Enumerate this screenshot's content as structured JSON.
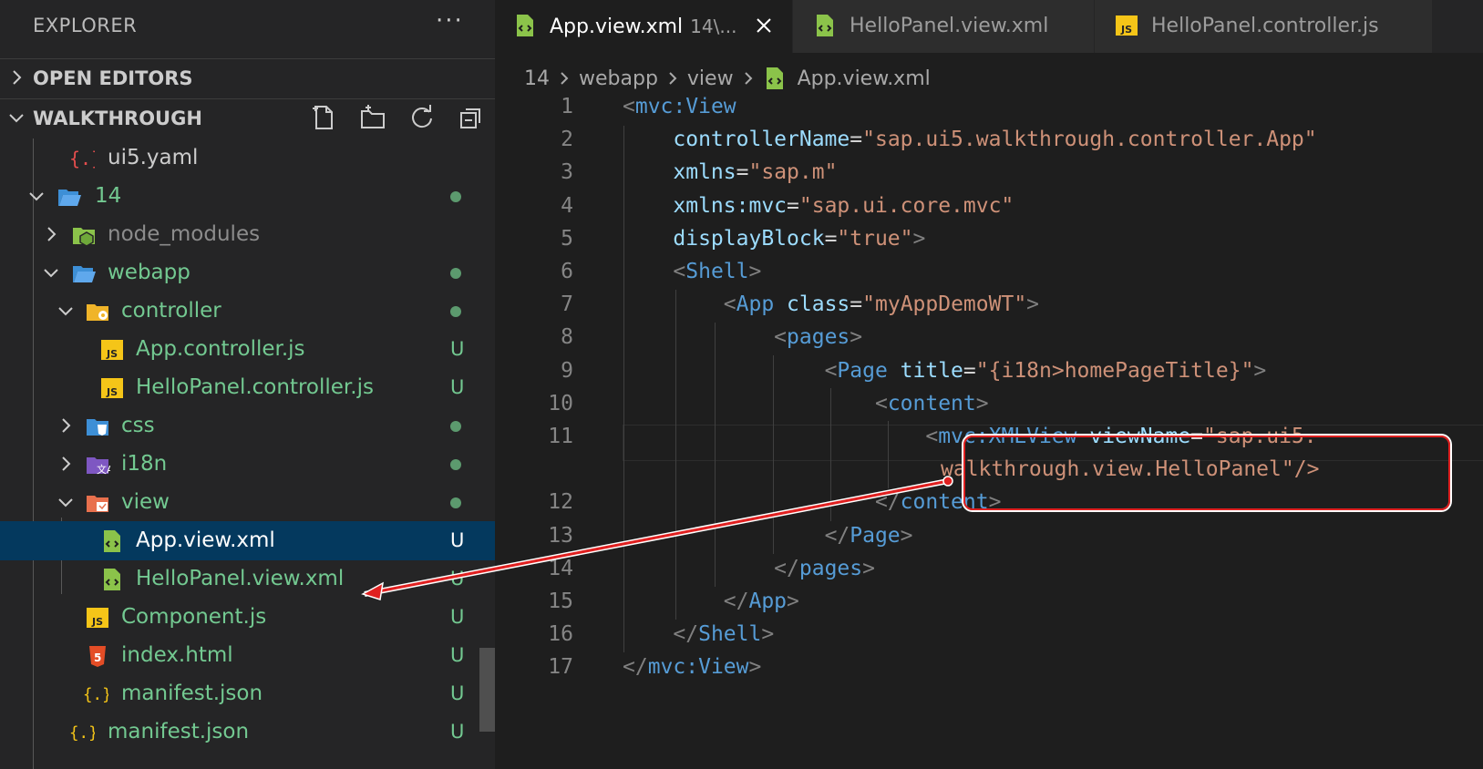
{
  "sidebar": {
    "title": "EXPLORER",
    "more": "···",
    "open_editors": "OPEN EDITORS",
    "workspace": "WALKTHROUGH",
    "tree": [
      {
        "name": "ui5.yaml",
        "icon": "yaml-icon",
        "status": "",
        "color": "#cccccc"
      },
      {
        "name": "14",
        "icon": "folder-open-icon",
        "status": "dot",
        "color": "#73c991"
      },
      {
        "name": "node_modules",
        "icon": "node-folder-icon",
        "status": "",
        "color": "#8c8c8c"
      },
      {
        "name": "webapp",
        "icon": "folder-open-icon",
        "status": "dot",
        "color": "#73c991"
      },
      {
        "name": "controller",
        "icon": "controller-folder-icon",
        "status": "dot",
        "color": "#73c991"
      },
      {
        "name": "App.controller.js",
        "icon": "js-file-icon",
        "status": "U",
        "color": "#73c991"
      },
      {
        "name": "HelloPanel.controller.js",
        "icon": "js-file-icon",
        "status": "U",
        "color": "#73c991"
      },
      {
        "name": "css",
        "icon": "css-folder-icon",
        "status": "dot",
        "color": "#73c991"
      },
      {
        "name": "i18n",
        "icon": "i18n-folder-icon",
        "status": "dot",
        "color": "#73c991"
      },
      {
        "name": "view",
        "icon": "view-folder-icon",
        "status": "dot",
        "color": "#73c991"
      },
      {
        "name": "App.view.xml",
        "icon": "xml-file-icon",
        "status": "U",
        "color": "#ffffff"
      },
      {
        "name": "HelloPanel.view.xml",
        "icon": "xml-file-icon",
        "status": "U",
        "color": "#73c991"
      },
      {
        "name": "Component.js",
        "icon": "js-file-icon",
        "status": "U",
        "color": "#73c991"
      },
      {
        "name": "index.html",
        "icon": "html-file-icon",
        "status": "U",
        "color": "#73c991"
      },
      {
        "name": "manifest.json",
        "icon": "json-file-icon",
        "status": "U",
        "color": "#73c991"
      },
      {
        "name": "manifest.json",
        "icon": "json-file-icon",
        "status": "U",
        "color": "#73c991"
      }
    ]
  },
  "tabs": [
    {
      "name": "App.view.xml",
      "desc": "14\\...",
      "active": true,
      "icon": "xml-file-icon"
    },
    {
      "name": "HelloPanel.view.xml",
      "desc": "",
      "active": false,
      "icon": "xml-file-icon"
    },
    {
      "name": "HelloPanel.controller.js",
      "desc": "",
      "active": false,
      "icon": "js-file-icon"
    }
  ],
  "breadcrumb": [
    "14",
    "webapp",
    "view",
    "App.view.xml"
  ],
  "editor": {
    "line_numbers": [
      "1",
      "2",
      "3",
      "4",
      "5",
      "6",
      "7",
      "8",
      "9",
      "10",
      "11",
      "12",
      "13",
      "14",
      "15",
      "16",
      "17"
    ],
    "lines": [
      "<mvc:View",
      "    controllerName=\"sap.ui5.walkthrough.controller.App\"",
      "    xmlns=\"sap.m\"",
      "    xmlns:mvc=\"sap.ui.core.mvc\"",
      "    displayBlock=\"true\">",
      "    <Shell>",
      "        <App class=\"myAppDemoWT\">",
      "            <pages>",
      "                <Page title=\"{i18n>homePageTitle}\">",
      "                    <content>",
      "                        <mvc:XMLView viewName=\"sap.ui5.",
      "walkthrough.view.HelloPanel\"/>",
      "                    </content>",
      "                </Page>",
      "            </pages>",
      "        </App>",
      "    </Shell>",
      "</mvc:View>"
    ]
  },
  "colors": {
    "accent_selection": "#04395e",
    "annotation_red": "#e02020",
    "git_untracked": "#73c991"
  }
}
